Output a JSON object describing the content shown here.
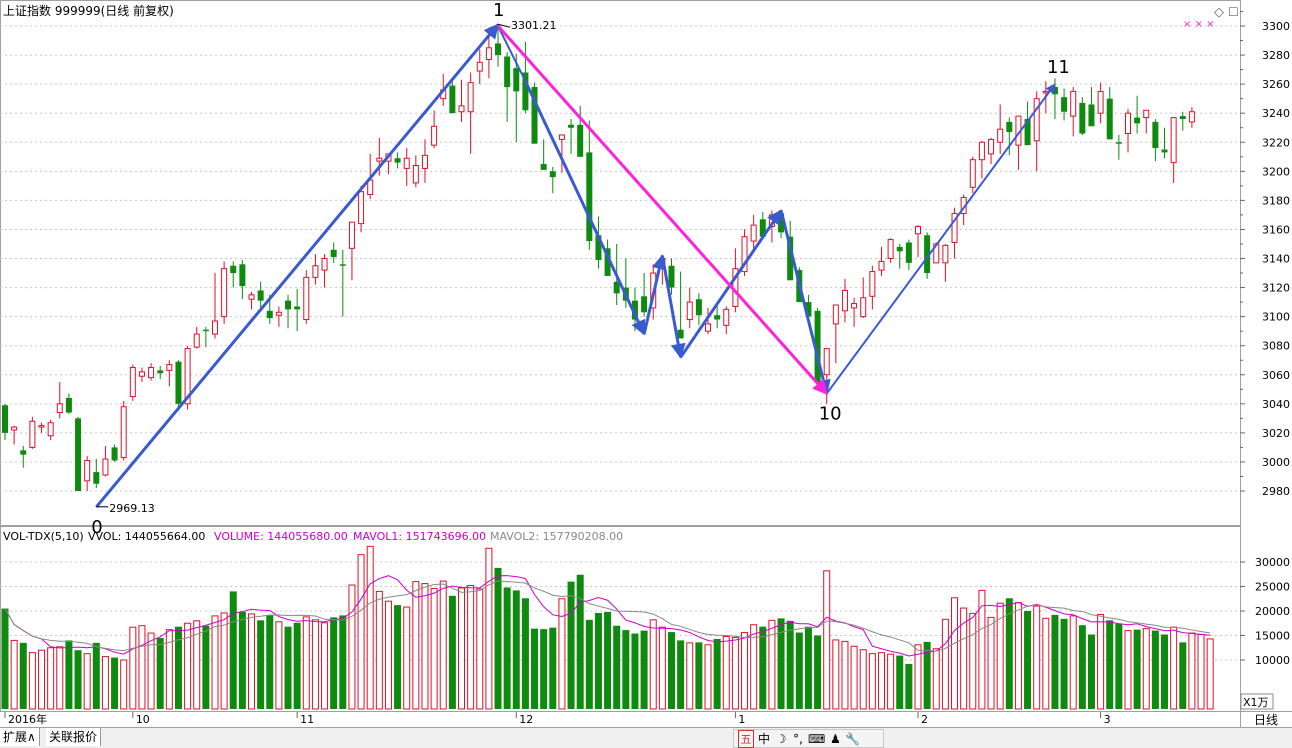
{
  "header": {
    "title": "上证指数 999999(日线 前复权)"
  },
  "volume_header": {
    "indicator": "VOL-TDX(5,10)",
    "vvol": "VVOL: 144055664.00",
    "volume": "VOLUME: 144055680.00",
    "mavol1": "MAVOL1: 151743696.00",
    "mavol2": "MAVOL2: 157790208.00"
  },
  "colors": {
    "up": "#e0102a",
    "down": "#0e8a0e",
    "wave": "#3a5bd0",
    "pink": "#ff22dd",
    "grid": "#c8c8c8",
    "mavol1": "#cc00cc",
    "mavol2": "#888888"
  },
  "chart_data": {
    "type": "candlestick",
    "price_axis": {
      "ylim": [
        2960,
        3305
      ],
      "ticks": [
        2980,
        3000,
        3020,
        3040,
        3060,
        3080,
        3100,
        3120,
        3140,
        3160,
        3180,
        3200,
        3220,
        3240,
        3260,
        3280,
        3300
      ]
    },
    "volume_axis": {
      "ylim": [
        0,
        34000
      ],
      "ticks": [
        10000,
        15000,
        20000,
        25000,
        30000
      ],
      "unit_label": "X1万"
    },
    "date_labels": [
      {
        "label": "2016年",
        "i": 0
      },
      {
        "label": "10",
        "i": 14
      },
      {
        "label": "11",
        "i": 32
      },
      {
        "label": "12",
        "i": 56
      },
      {
        "label": "1",
        "i": 80
      },
      {
        "label": "2",
        "i": 100
      },
      {
        "label": "3",
        "i": 120
      }
    ],
    "period_label": "日线",
    "annotations": [
      {
        "label": "0",
        "i": 10,
        "price": 2969.13
      },
      {
        "label": "1",
        "i": 54,
        "price": 3301.21
      },
      {
        "label": "10",
        "i": 90,
        "price": 3047
      },
      {
        "label": "11",
        "i": 115,
        "price": 3262
      }
    ],
    "value_labels": [
      {
        "text": "2969.13",
        "i": 10,
        "price": 2969.13
      },
      {
        "text": "3301.21",
        "i": 54,
        "price": 3301.21
      }
    ],
    "wave_lines": [
      {
        "color": "wave",
        "arrow": true,
        "points": [
          [
            10,
            2969
          ],
          [
            54,
            3301
          ]
        ]
      },
      {
        "color": "wave",
        "arrow": false,
        "thin": true,
        "points": [
          [
            54,
            3300
          ],
          [
            57,
            3262
          ]
        ]
      },
      {
        "color": "wave",
        "arrow": true,
        "points": [
          [
            57,
            3262
          ],
          [
            70,
            3088
          ]
        ]
      },
      {
        "color": "wave",
        "arrow": true,
        "points": [
          [
            70,
            3088
          ],
          [
            72,
            3142
          ]
        ]
      },
      {
        "color": "wave",
        "arrow": true,
        "points": [
          [
            72,
            3142
          ],
          [
            74,
            3072
          ]
        ]
      },
      {
        "color": "wave",
        "arrow": true,
        "points": [
          [
            74,
            3072
          ],
          [
            85,
            3173
          ]
        ]
      },
      {
        "color": "wave",
        "arrow": true,
        "points": [
          [
            85,
            3173
          ],
          [
            90,
            3047
          ]
        ]
      },
      {
        "color": "wave",
        "arrow": true,
        "thin": true,
        "points": [
          [
            90,
            3047
          ],
          [
            115,
            3260
          ]
        ]
      },
      {
        "color": "pink",
        "arrow": true,
        "points": [
          [
            54,
            3300
          ],
          [
            90,
            3047
          ]
        ]
      }
    ],
    "candles": [
      [
        3039,
        3040,
        3015,
        3020
      ],
      [
        3022,
        3025,
        3012,
        3024
      ],
      [
        3008,
        3011,
        2996,
        3005
      ],
      [
        3010,
        3031,
        3009,
        3028
      ],
      [
        3024,
        3027,
        3020,
        3025
      ],
      [
        3018,
        3029,
        3015,
        3027
      ],
      [
        3034,
        3055,
        3030,
        3040
      ],
      [
        3044,
        3047,
        3033,
        3034
      ],
      [
        3030,
        3031,
        2983,
        2980
      ],
      [
        2987,
        3004,
        2980,
        3001
      ],
      [
        2993,
        3002,
        2982,
        2985
      ],
      [
        2991,
        3011,
        2990,
        3002
      ],
      [
        3010,
        3012,
        3000,
        3001
      ],
      [
        3003,
        3042,
        3001,
        3038
      ],
      [
        3045,
        3067,
        3042,
        3065
      ],
      [
        3059,
        3065,
        3055,
        3062
      ],
      [
        3058,
        3068,
        3056,
        3065
      ],
      [
        3063,
        3066,
        3057,
        3061
      ],
      [
        3063,
        3070,
        3052,
        3067
      ],
      [
        3069,
        3070,
        3035,
        3040
      ],
      [
        3040,
        3080,
        3036,
        3078
      ],
      [
        3079,
        3093,
        3078,
        3088
      ],
      [
        3091,
        3093,
        3079,
        3090
      ],
      [
        3088,
        3130,
        3085,
        3097
      ],
      [
        3100,
        3138,
        3095,
        3133
      ],
      [
        3135,
        3138,
        3120,
        3130
      ],
      [
        3136,
        3139,
        3112,
        3121
      ],
      [
        3112,
        3117,
        3105,
        3115
      ],
      [
        3118,
        3124,
        3104,
        3111
      ],
      [
        3104,
        3115,
        3095,
        3099
      ],
      [
        3101,
        3107,
        3093,
        3103
      ],
      [
        3111,
        3115,
        3092,
        3105
      ],
      [
        3107,
        3119,
        3090,
        3105
      ],
      [
        3098,
        3132,
        3095,
        3127
      ],
      [
        3127,
        3143,
        3122,
        3135
      ],
      [
        3132,
        3143,
        3120,
        3140
      ],
      [
        3146,
        3151,
        3137,
        3141
      ],
      [
        3136,
        3146,
        3100,
        3135
      ],
      [
        3147,
        3160,
        3125,
        3165
      ],
      [
        3164,
        3190,
        3158,
        3186
      ],
      [
        3184,
        3212,
        3181,
        3194
      ],
      [
        3207,
        3223,
        3197,
        3209
      ],
      [
        3207,
        3212,
        3198,
        3212
      ],
      [
        3209,
        3213,
        3202,
        3206
      ],
      [
        3202,
        3216,
        3190,
        3209
      ],
      [
        3192,
        3211,
        3189,
        3204
      ],
      [
        3202,
        3222,
        3192,
        3211
      ],
      [
        3218,
        3242,
        3216,
        3231
      ],
      [
        3250,
        3267,
        3245,
        3256
      ],
      [
        3259,
        3264,
        3248,
        3240
      ],
      [
        3241,
        3263,
        3234,
        3245
      ],
      [
        3241,
        3268,
        3212,
        3261
      ],
      [
        3269,
        3284,
        3260,
        3275
      ],
      [
        3277,
        3299,
        3264,
        3285
      ],
      [
        3288,
        3301,
        3272,
        3280
      ],
      [
        3279,
        3282,
        3234,
        3258
      ],
      [
        3271,
        3281,
        3220,
        3255
      ],
      [
        3268,
        3289,
        3240,
        3242
      ],
      [
        3258,
        3261,
        3243,
        3219
      ],
      [
        3205,
        3222,
        3201,
        3201
      ],
      [
        3200,
        3203,
        3185,
        3196
      ],
      [
        3222,
        3223,
        3199,
        3225
      ],
      [
        3232,
        3236,
        3212,
        3230
      ],
      [
        3232,
        3245,
        3210,
        3210
      ],
      [
        3213,
        3235,
        3146,
        3152
      ],
      [
        3156,
        3169,
        3133,
        3139
      ],
      [
        3147,
        3153,
        3128,
        3128
      ],
      [
        3124,
        3150,
        3108,
        3116
      ],
      [
        3120,
        3140,
        3106,
        3111
      ],
      [
        3111,
        3120,
        3090,
        3098
      ],
      [
        3114,
        3130,
        3100,
        3103
      ],
      [
        3106,
        3136,
        3098,
        3130
      ],
      [
        3136,
        3142,
        3122,
        3140
      ],
      [
        3135,
        3140,
        3115,
        3120
      ],
      [
        3091,
        3131,
        3087,
        3085
      ],
      [
        3098,
        3120,
        3092,
        3110
      ],
      [
        3112,
        3116,
        3094,
        3101
      ],
      [
        3090,
        3106,
        3088,
        3095
      ],
      [
        3101,
        3107,
        3092,
        3098
      ],
      [
        3094,
        3107,
        3088,
        3105
      ],
      [
        3107,
        3147,
        3103,
        3133
      ],
      [
        3131,
        3160,
        3128,
        3155
      ],
      [
        3152,
        3170,
        3145,
        3163
      ],
      [
        3167,
        3172,
        3155,
        3155
      ],
      [
        3162,
        3173,
        3151,
        3170
      ],
      [
        3171,
        3166,
        3154,
        3158
      ],
      [
        3155,
        3166,
        3133,
        3125
      ],
      [
        3132,
        3134,
        3112,
        3110
      ],
      [
        3110,
        3115,
        3101,
        3100
      ],
      [
        3104,
        3106,
        3057,
        3055
      ],
      [
        3060,
        3062,
        3040,
        3078
      ],
      [
        3095,
        3103,
        3068,
        3108
      ],
      [
        3104,
        3126,
        3096,
        3118
      ],
      [
        3106,
        3113,
        3093,
        3109
      ],
      [
        3100,
        3127,
        3099,
        3113
      ],
      [
        3114,
        3135,
        3105,
        3131
      ],
      [
        3132,
        3148,
        3128,
        3138
      ],
      [
        3140,
        3154,
        3137,
        3153
      ],
      [
        3148,
        3150,
        3133,
        3145
      ],
      [
        3151,
        3153,
        3132,
        3137
      ],
      [
        3157,
        3163,
        3141,
        3162
      ],
      [
        3156,
        3158,
        3126,
        3130
      ],
      [
        3137,
        3151,
        3140,
        3150
      ],
      [
        3137,
        3150,
        3124,
        3149
      ],
      [
        3151,
        3175,
        3140,
        3171
      ],
      [
        3171,
        3184,
        3163,
        3182
      ],
      [
        3189,
        3210,
        3185,
        3208
      ],
      [
        3208,
        3221,
        3195,
        3220
      ],
      [
        3212,
        3223,
        3205,
        3222
      ],
      [
        3220,
        3246,
        3212,
        3229
      ],
      [
        3234,
        3237,
        3211,
        3227
      ],
      [
        3218,
        3238,
        3201,
        3238
      ],
      [
        3236,
        3248,
        3230,
        3218
      ],
      [
        3221,
        3255,
        3200,
        3250
      ],
      [
        3254,
        3262,
        3240,
        3255
      ],
      [
        3258,
        3264,
        3236,
        3253
      ],
      [
        3251,
        3257,
        3235,
        3241
      ],
      [
        3238,
        3258,
        3224,
        3255
      ],
      [
        3247,
        3251,
        3225,
        3226
      ],
      [
        3246,
        3258,
        3232,
        3231
      ],
      [
        3240,
        3261,
        3233,
        3255
      ],
      [
        3250,
        3258,
        3224,
        3222
      ],
      [
        3220,
        3225,
        3208,
        3219
      ],
      [
        3226,
        3243,
        3213,
        3240
      ],
      [
        3237,
        3252,
        3226,
        3233
      ],
      [
        3237,
        3242,
        3226,
        3242
      ],
      [
        3234,
        3236,
        3207,
        3216
      ],
      [
        3215,
        3230,
        3209,
        3213
      ],
      [
        3206,
        3226,
        3192,
        3237
      ],
      [
        3238,
        3241,
        3228,
        3236
      ],
      [
        3234,
        3244,
        3230,
        3241
      ]
    ],
    "volumes": [
      20500,
      14000,
      13500,
      11500,
      12000,
      12500,
      12700,
      14000,
      12000,
      11300,
      13500,
      10700,
      10500,
      10000,
      16700,
      17000,
      15500,
      14500,
      16200,
      16800,
      17500,
      18000,
      17000,
      19000,
      19600,
      24000,
      19800,
      19400,
      18100,
      19200,
      17800,
      16800,
      17600,
      18800,
      18200,
      17600,
      18700,
      19100,
      25300,
      31500,
      33200,
      24000,
      22000,
      21200,
      20800,
      26000,
      25600,
      24600,
      26100,
      23100,
      24700,
      25200,
      24500,
      32800,
      28800,
      24800,
      24200,
      22600,
      16400,
      16300,
      16600,
      22500,
      26000,
      27400,
      18200,
      19600,
      19800,
      17000,
      16100,
      15400,
      16000,
      18200,
      16700,
      15700,
      14000,
      13500,
      13600,
      13100,
      14300,
      14800,
      14600,
      15600,
      17200,
      16800,
      18100,
      18500,
      18000,
      15600,
      16800,
      15000,
      28200,
      14100,
      13800,
      12800,
      12100,
      11300,
      11500,
      11200,
      10900,
      9200,
      13100,
      13700,
      12300,
      18300,
      22700,
      20600,
      19500,
      24200,
      18700,
      21600,
      22600,
      21700,
      20000,
      21000,
      18500,
      19200,
      18400,
      19000,
      17100,
      15200,
      19300,
      18100,
      17400,
      16000,
      16200,
      16400,
      16000,
      15200,
      16700,
      13600,
      15500,
      15200,
      14300
    ],
    "mavol1_note": "5-day average of volume",
    "mavol2_note": "10-day average of volume"
  },
  "bottombar": {
    "tab1": "扩展∧",
    "tab2": "关联报价",
    "ime": [
      "五",
      "中",
      "☽",
      "°,",
      "⌨",
      "♟",
      "🔧"
    ]
  },
  "topright": {
    "diamond": "◇",
    "square": "☐",
    "dots": "× × ×"
  }
}
